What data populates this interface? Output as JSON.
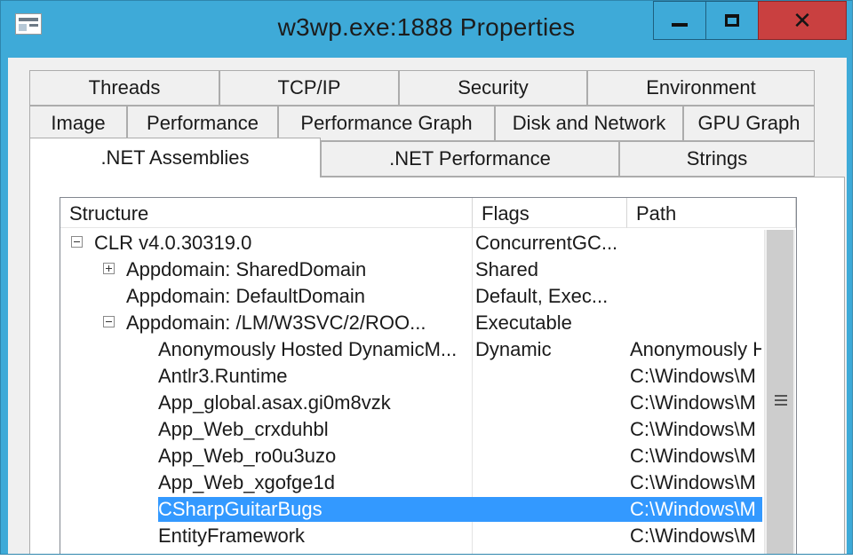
{
  "window": {
    "title": "w3wp.exe:1888 Properties",
    "controls": {
      "minimize": "minimize",
      "maximize": "maximize",
      "close": "close"
    },
    "colors": {
      "frame": "#3eaad8",
      "close_button": "#c94040",
      "selection": "#3399ff"
    }
  },
  "tabs": {
    "row1": [
      "Threads",
      "TCP/IP",
      "Security",
      "Environment"
    ],
    "row2": [
      "Image",
      "Performance",
      "Performance Graph",
      "Disk and Network",
      "GPU Graph"
    ],
    "row3": [
      ".NET Assemblies",
      ".NET Performance",
      "Strings"
    ],
    "active": ".NET Assemblies"
  },
  "listview": {
    "columns": [
      "Structure",
      "Flags",
      "Path"
    ],
    "rows": [
      {
        "structure": "CLR v4.0.30319.0",
        "flags": "ConcurrentGC...",
        "path": "",
        "expander": "minus",
        "level": 0
      },
      {
        "structure": "Appdomain: SharedDomain",
        "flags": "Shared",
        "path": "",
        "expander": "plus",
        "level": 1
      },
      {
        "structure": "Appdomain: DefaultDomain",
        "flags": "Default, Exec...",
        "path": "",
        "expander": "",
        "level": 1
      },
      {
        "structure": "Appdomain: /LM/W3SVC/2/ROO...",
        "flags": "Executable",
        "path": "",
        "expander": "minus",
        "level": 1
      },
      {
        "structure": "Anonymously Hosted DynamicM...",
        "flags": "Dynamic",
        "path": "Anonymously H",
        "expander": "",
        "level": 2
      },
      {
        "structure": "Antlr3.Runtime",
        "flags": "",
        "path": "C:\\Windows\\M",
        "expander": "",
        "level": 2
      },
      {
        "structure": "App_global.asax.gi0m8vzk",
        "flags": "",
        "path": "C:\\Windows\\M",
        "expander": "",
        "level": 2
      },
      {
        "structure": "App_Web_crxduhbl",
        "flags": "",
        "path": "C:\\Windows\\M",
        "expander": "",
        "level": 2
      },
      {
        "structure": "App_Web_ro0u3uzo",
        "flags": "",
        "path": "C:\\Windows\\M",
        "expander": "",
        "level": 2
      },
      {
        "structure": "App_Web_xgofge1d",
        "flags": "",
        "path": "C:\\Windows\\M",
        "expander": "",
        "level": 2
      },
      {
        "structure": "CSharpGuitarBugs",
        "flags": "",
        "path": "C:\\Windows\\M",
        "expander": "",
        "level": 2,
        "selected": true
      },
      {
        "structure": "EntityFramework",
        "flags": "",
        "path": "C:\\Windows\\M",
        "expander": "",
        "level": 2
      }
    ]
  }
}
